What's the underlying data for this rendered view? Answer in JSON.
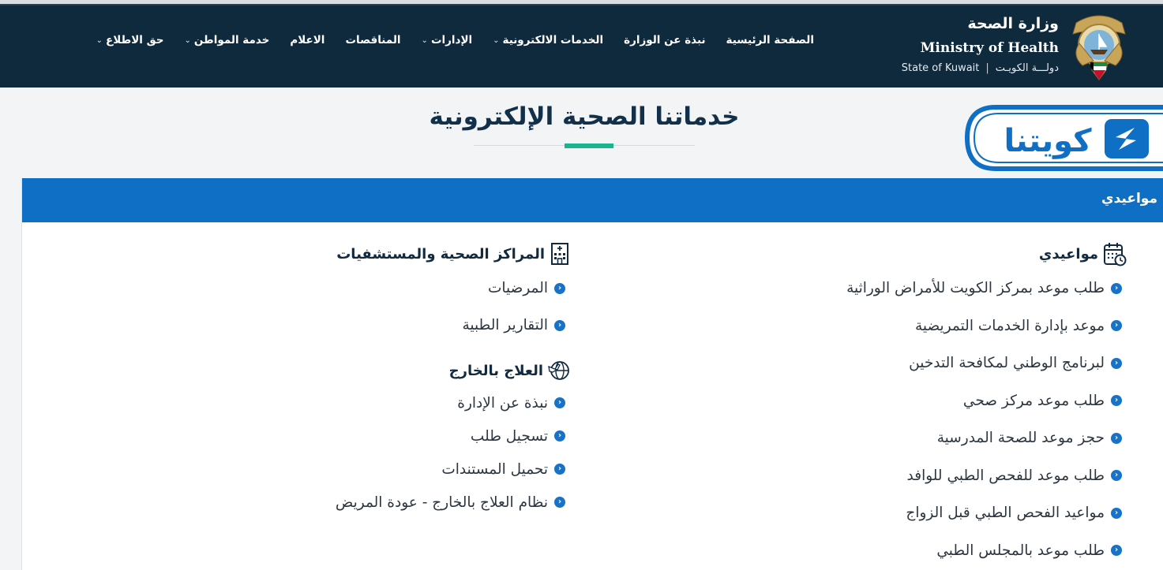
{
  "header": {
    "brand_ar": "وزارة الصحة",
    "brand_en": "Ministry of Health",
    "sub_ar": "دولـــة الكويـت",
    "sub_sep": "|",
    "sub_en": "State of Kuwait",
    "bg_color": "#0f2a3d"
  },
  "nav": {
    "items": [
      {
        "label": "الصفحة الرئيسية",
        "dropdown": false
      },
      {
        "label": "نبذة عن الوزارة",
        "dropdown": false
      },
      {
        "label": "الخدمات الالكترونية",
        "dropdown": true
      },
      {
        "label": "الإدارات",
        "dropdown": true
      },
      {
        "label": "المناقصات",
        "dropdown": false
      },
      {
        "label": "الاعلام",
        "dropdown": false
      },
      {
        "label": "خدمة المواطن",
        "dropdown": true
      },
      {
        "label": "حق الاطلاع",
        "dropdown": true
      }
    ],
    "chevron": "⌄"
  },
  "kuwaitna_logo": {
    "text": "كويتنا",
    "color": "#0f6fc4"
  },
  "section": {
    "title": "خدماتنا الصحية الإلكترونية",
    "accent_color": "#1bb28e"
  },
  "card": {
    "header_label": "مواعيدي",
    "header_color": "#0f6fc4",
    "groups": {
      "appointments": {
        "title": "مواعيدي",
        "icon": "calendar-clock-icon",
        "links": [
          "طلب موعد بمركز الكويت للأمراض الوراثية",
          "موعد بإدارة الخدمات التمريضية",
          "لبرنامج الوطني لمكافحة التدخين",
          "طلب موعد مركز صحي",
          "حجز موعد للصحة المدرسية",
          "طلب موعد للفحص الطبي للوافد",
          "مواعيد الفحص الطبي قبل الزواج",
          "طلب موعد بالمجلس الطبي"
        ]
      },
      "centers": {
        "title": "المراكز الصحية والمستشفيات",
        "icon": "hospital-building-icon",
        "links": [
          "المرضيات",
          "التقارير الطبية"
        ]
      },
      "abroad": {
        "title": "العلاج بالخارج",
        "icon": "globe-plane-icon",
        "links": [
          "نبذة عن الإدارة",
          "تسجيل طلب",
          "تحميل المستندات",
          "نظام العلاج بالخارج - عودة المريض"
        ]
      }
    },
    "bullet_color": "#1873c8"
  }
}
